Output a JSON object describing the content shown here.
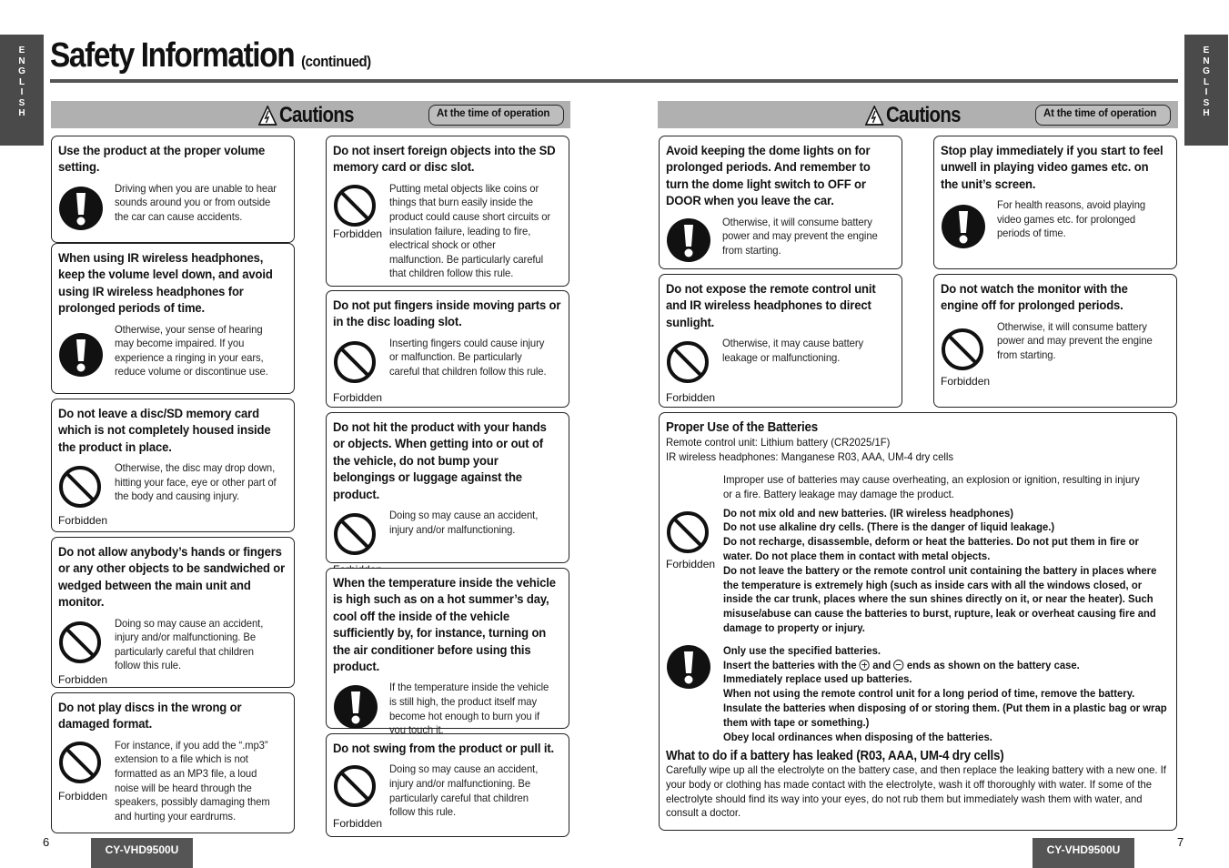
{
  "language_tab": "ENGLISH",
  "title": "Safety Information",
  "title_suffix": "(continued)",
  "band": {
    "heading": "Cautions",
    "badge": "At the time of operation"
  },
  "forbidden_label": "Forbidden",
  "left_page": {
    "page_number": "6",
    "model": "CY-VHD9500U",
    "col1": [
      {
        "heading": "Use the product at the proper volume setting.",
        "icon": "mandatory-icon",
        "text": "Driving when you are unable to hear sounds around you or from outside the car can cause accidents."
      },
      {
        "heading": "When using IR wireless headphones, keep the volume level down, and avoid using IR wireless headphones for prolonged periods of time.",
        "icon": "mandatory-icon",
        "text": "Otherwise, your sense of hearing may become impaired. If you experience a ringing in your ears, reduce volume or discontinue use."
      },
      {
        "heading": "Do not leave a disc/SD memory card which is not completely housed inside the product in place.",
        "icon": "forbidden-icon",
        "text": "Otherwise, the disc may drop down, hitting your face, eye or other part of the body and causing injury."
      },
      {
        "heading": "Do not allow anybody’s hands or fingers or any other objects to be sandwiched or wedged between the main unit and monitor.",
        "icon": "forbidden-icon",
        "text": "Doing so may cause an accident, injury and/or malfunctioning. Be particularly careful that children follow this rule."
      },
      {
        "heading": "Do not play discs in the wrong or damaged format.",
        "icon": "forbidden-icon",
        "text": "For instance, if you add the “.mp3” extension to a file which is not formatted as an MP3 file, a loud noise will be heard through the speakers, possibly damaging them and hurting your eardrums."
      }
    ],
    "col2": [
      {
        "heading": "Do not insert foreign objects into the SD memory card or disc slot.",
        "icon": "forbidden-icon",
        "text": "Putting metal objects like coins or things that burn easily inside the product could cause short circuits or insulation failure, leading to fire, electrical shock or other malfunction. Be particularly careful that children follow this rule."
      },
      {
        "heading": "Do not put fingers inside moving parts or in the disc loading slot.",
        "icon": "forbidden-icon",
        "text": "Inserting fingers could cause injury or malfunction. Be particularly careful that children follow this rule."
      },
      {
        "heading": "Do not hit the product with your hands or objects.  When getting into or out of the vehicle, do not bump your belongings or luggage against the product.",
        "icon": "forbidden-icon",
        "text": "Doing so may cause an accident, injury and/or malfunctioning."
      },
      {
        "heading": "When the temperature inside the vehicle is high such as on a hot summer’s day, cool off the inside of the vehicle sufficiently by, for instance, turning on the air conditioner before using this product.",
        "icon": "mandatory-icon",
        "text": "If the temperature inside the vehicle is still high, the product itself may become hot enough to burn you if you touch it."
      },
      {
        "heading": "Do not swing from the product or pull it.",
        "icon": "forbidden-icon",
        "text": "Doing so may cause an accident, injury and/or malfunctioning. Be particularly careful that children follow this rule."
      }
    ]
  },
  "right_page": {
    "page_number": "7",
    "model": "CY-VHD9500U",
    "col1": [
      {
        "heading": "Avoid keeping the dome lights on for prolonged periods. And remember to turn the dome light switch to OFF or DOOR when you leave the car.",
        "icon": "mandatory-icon",
        "text": "Otherwise, it will consume battery power and may prevent the engine from starting."
      },
      {
        "heading": "Do not expose the remote control unit and IR wireless headphones to direct sunlight.",
        "icon": "forbidden-icon",
        "text": "Otherwise, it may cause battery leakage or malfunctioning."
      }
    ],
    "col2": [
      {
        "heading": "Stop play immediately if you start to feel unwell in playing video games etc. on the unit’s screen.",
        "icon": "mandatory-icon",
        "text": "For health reasons, avoid playing video games etc. for prolonged periods of time."
      },
      {
        "heading": "Do not watch the monitor with the engine off for prolonged periods.",
        "icon": "forbidden-icon",
        "text": "Otherwise, it will consume battery power and may prevent the engine from starting."
      }
    ],
    "batteries": {
      "heading": "Proper Use of the Batteries",
      "lines": [
        "Remote control unit: Lithium battery (CR2025/1F)",
        "IR wireless headphones: Manganese R03, AAA, UM-4 dry cells"
      ],
      "intro": "Improper use of batteries may cause overheating, an explosion or ignition, resulting in injury or a fire. Battery leakage may damage the product.",
      "forbidden_items": [
        "Do not mix old and new batteries. (IR wireless headphones)",
        "Do not use alkaline dry cells. (There is the danger of liquid leakage.)",
        "Do not recharge, disassemble, deform or heat the batteries. Do not put them in fire or water. Do not place them in contact with metal objects.",
        "Do not leave the battery or the remote control unit containing the battery in places where the temperature is extremely high (such as inside cars with all the windows closed, or inside the car trunk, places where the sun shines directly on it, or near the heater). Such misuse/abuse can cause the batteries to burst, rupture, leak or overheat causing fire and damage to property or injury."
      ],
      "mandatory_items": {
        "item1": "Only use the specified batteries.",
        "item2_before": "Insert the batteries with the",
        "item2_and": "and",
        "item2_after": "ends as shown on the battery case.",
        "item3": "Immediately replace used up batteries.",
        "item4": "When not using the remote control unit for a long period of time, remove the battery.",
        "item5": "Insulate the batteries when disposing of or storing them. (Put them in a plastic bag or wrap them with tape or something.)",
        "item6": "Obey local ordinances when disposing of the batteries."
      },
      "leak_heading": "What to do if a battery has leaked (R03, AAA, UM-4 dry cells)",
      "leak_text": "Carefully wipe up all the electrolyte on the battery case, and then replace the leaking battery with a new one. If your body or clothing has made contact with the electrolyte, wash it off thoroughly with water. If some of the electrolyte should find its way into your eyes, do not rub them but immediately wash them with water, and consult a doctor."
    }
  }
}
